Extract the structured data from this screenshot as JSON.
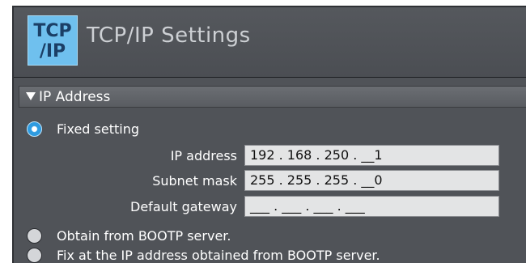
{
  "header": {
    "icon_line1": "TCP",
    "icon_line2": "/IP",
    "title": "TCP/IP Settings"
  },
  "section": {
    "title": "IP Address",
    "expanded": true
  },
  "options": {
    "fixed": {
      "label": "Fixed setting",
      "selected": true
    },
    "bootp": {
      "label": "Obtain from BOOTP server.",
      "selected": false
    },
    "bootp_fix": {
      "label": "Fix at the IP address obtained from BOOTP server.",
      "selected": false
    }
  },
  "fields": {
    "ip_address": {
      "label": "IP address",
      "value": "192 . 168 . 250 . __1"
    },
    "subnet_mask": {
      "label": "Subnet mask",
      "value": "255 . 255 . 255 . __0"
    },
    "default_gateway": {
      "label": "Default gateway",
      "value": "___ . ___ . ___ . ___"
    }
  },
  "colors": {
    "accent": "#2e9be0",
    "panel": "#505358",
    "icon_bg": "#6fc0ee"
  }
}
